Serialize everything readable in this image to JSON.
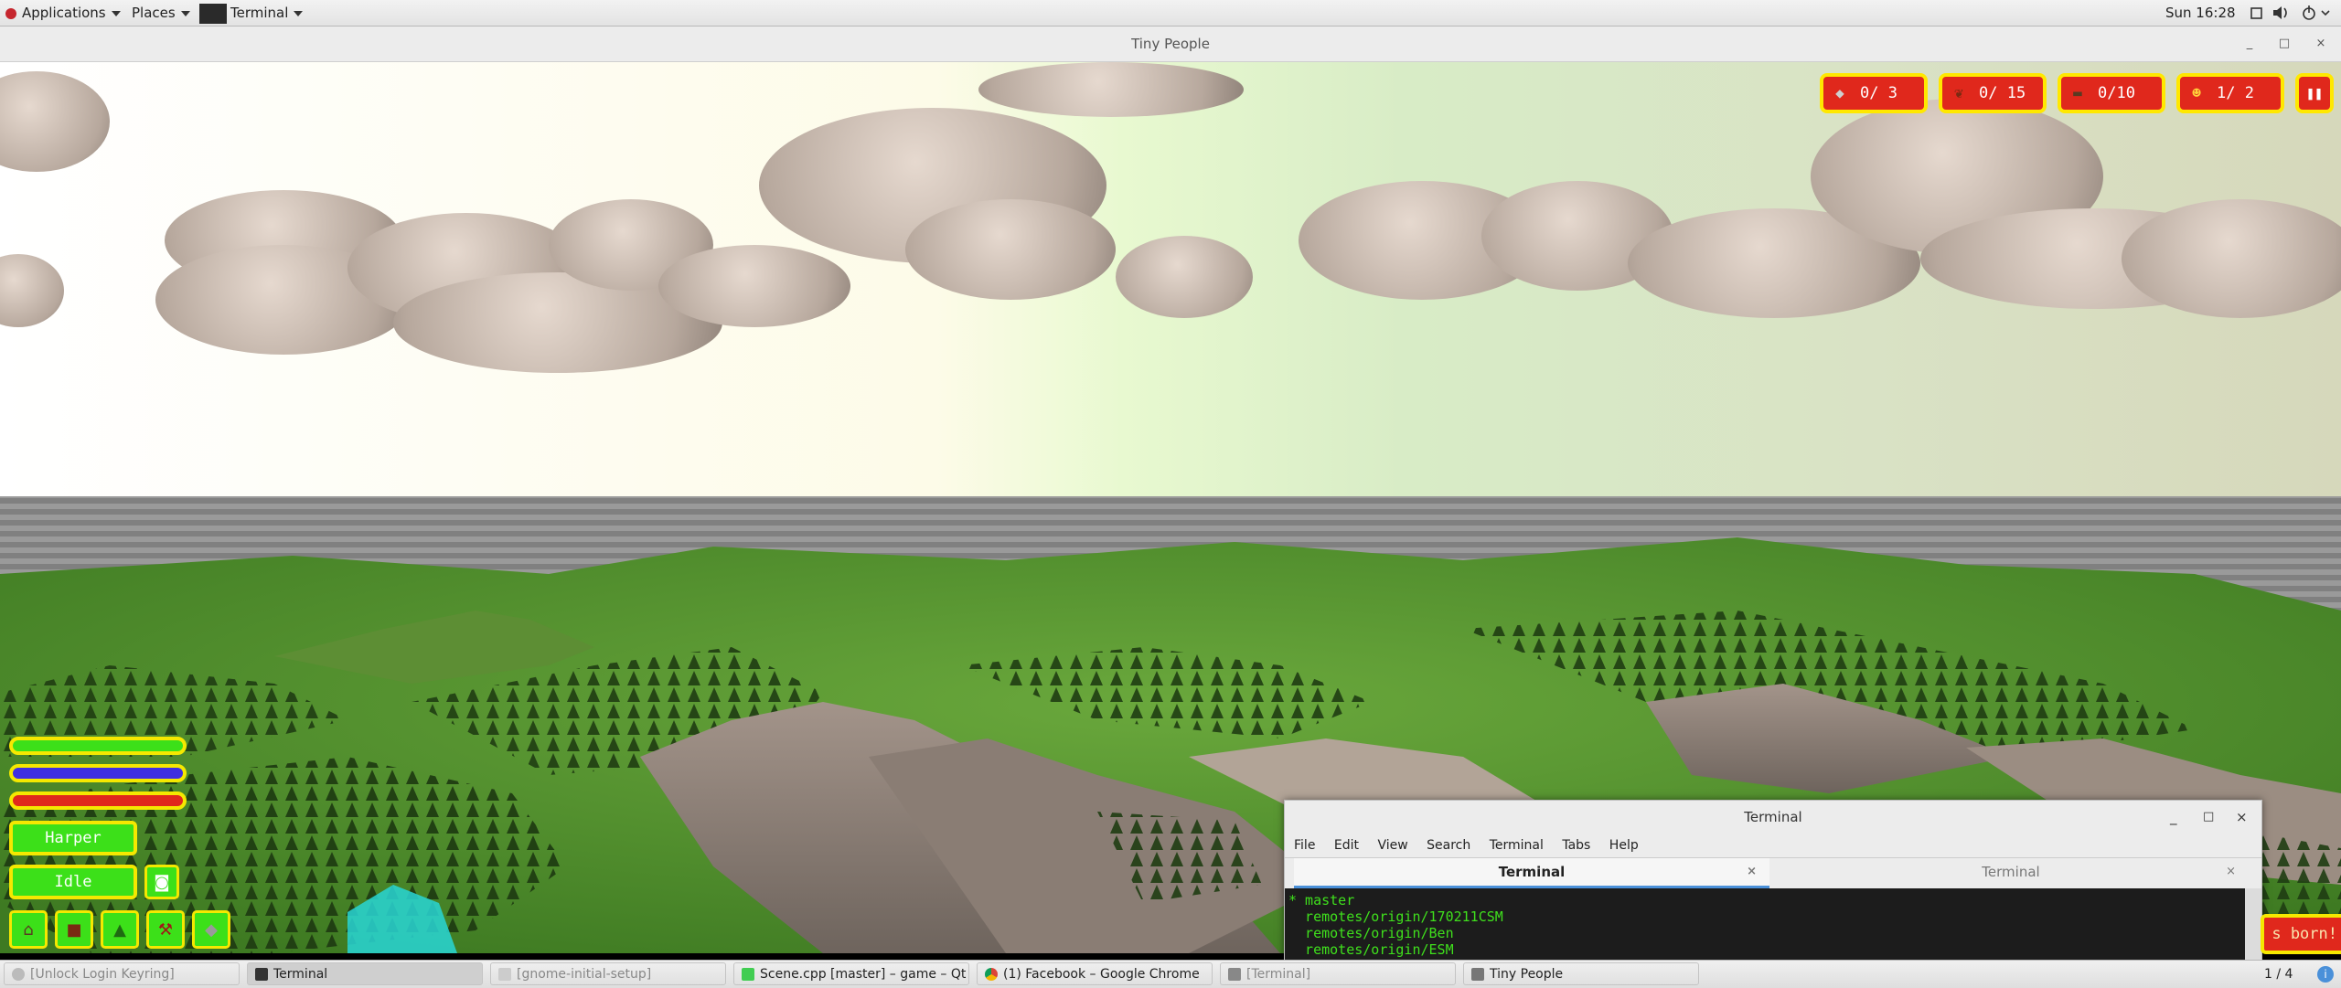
{
  "topbar": {
    "applications": "Applications",
    "places": "Places",
    "active_app": "Terminal",
    "clock": "Sun 16:28"
  },
  "window": {
    "title": "Tiny People"
  },
  "game": {
    "resources": [
      {
        "name": "stone",
        "icon": "stone-icon",
        "value": "0/ 3"
      },
      {
        "name": "wood",
        "icon": "wood-icon",
        "value": "0/ 15"
      },
      {
        "name": "logs",
        "icon": "logs-icon",
        "value": "0/10"
      },
      {
        "name": "people",
        "icon": "person-icon",
        "value": "1/ 2"
      }
    ],
    "character_name": "Harper",
    "character_state": "Idle",
    "stat_bars": [
      {
        "name": "health",
        "color": "#3ce019",
        "fill": 1.0
      },
      {
        "name": "energy",
        "color": "#3f2fe0",
        "fill": 1.0
      },
      {
        "name": "hunger",
        "color": "#e0281c",
        "fill": 1.0
      }
    ],
    "toast": "s born!"
  },
  "terminal": {
    "title": "Terminal",
    "menu": [
      "File",
      "Edit",
      "View",
      "Search",
      "Terminal",
      "Tabs",
      "Help"
    ],
    "tabs": [
      "Terminal",
      "Terminal"
    ],
    "lines": [
      "* master",
      "  remotes/origin/170211CSM",
      "  remotes/origin/Ben",
      "  remotes/origin/ESM"
    ]
  },
  "taskbar": {
    "items": [
      {
        "label": "[Unlock Login Keyring]",
        "state": "inactive"
      },
      {
        "label": "Terminal",
        "state": "active"
      },
      {
        "label": "[gnome-initial-setup]",
        "state": "inactive"
      },
      {
        "label": "Scene.cpp [master] – game – Qt C…",
        "state": "normal"
      },
      {
        "label": "(1) Facebook – Google Chrome",
        "state": "normal"
      },
      {
        "label": "[Terminal]",
        "state": "inactive"
      },
      {
        "label": "Tiny People",
        "state": "normal"
      }
    ],
    "workspace": "1 / 4"
  }
}
